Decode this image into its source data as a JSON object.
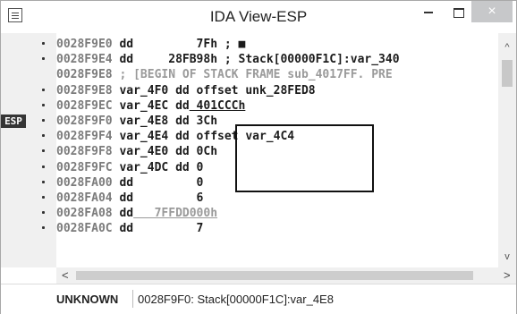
{
  "window": {
    "title": "IDA View-ESP",
    "system_icon": "document-icon",
    "minimize_label": "–",
    "maximize_label": "□",
    "close_label": "×"
  },
  "esp_marker": "ESP",
  "lines": [
    {
      "addr": "0028F9E0",
      "op": "dd",
      "rest": "        7Fh ; ■",
      "style": "normal",
      "dot": true
    },
    {
      "addr": "0028F9E4",
      "op": "dd",
      "rest": "    28FB98h ; Stack[00000F1C]:var_340",
      "style": "normal",
      "dot": true
    },
    {
      "addr": "0028F9E8",
      "op": "",
      "rest": "; [BEGIN OF STACK FRAME sub_4017FF. PRE",
      "style": "comment",
      "dot": false
    },
    {
      "addr": "0028F9E8",
      "op": "var_4F0 dd",
      "rest": "offset unk_28FED8",
      "style": "normal",
      "dot": true
    },
    {
      "addr": "0028F9EC",
      "op": "var_4EC dd",
      "rest": "401CCCh",
      "style": "underline",
      "dot": true
    },
    {
      "addr": "0028F9F0",
      "op": "var_4E8 dd",
      "rest": "3Ch",
      "style": "normal",
      "dot": true
    },
    {
      "addr": "0028F9F4",
      "op": "var_4E4 dd",
      "rest": "offset var_4C4",
      "style": "normal",
      "dot": true
    },
    {
      "addr": "0028F9F8",
      "op": "var_4E0 dd",
      "rest": "0Ch",
      "style": "normal",
      "dot": true
    },
    {
      "addr": "0028F9FC",
      "op": "var_4DC dd",
      "rest": "0",
      "style": "normal",
      "dot": true
    },
    {
      "addr": "0028FA00",
      "op": "dd",
      "rest": "        0",
      "style": "normal",
      "dot": true
    },
    {
      "addr": "0028FA04",
      "op": "dd",
      "rest": "        6",
      "style": "normal",
      "dot": true
    },
    {
      "addr": "0028FA08",
      "op": "dd",
      "rest": "  7FFDD000h",
      "style": "dimunderline",
      "dot": true
    },
    {
      "addr": "0028FA0C",
      "op": "dd",
      "rest": "        7",
      "style": "normal",
      "dot": true
    }
  ],
  "scroll": {
    "up_icon": "chevron-up-icon",
    "down_icon": "chevron-down-icon",
    "left_icon": "chevron-left-icon",
    "right_icon": "chevron-right-icon",
    "up": "^",
    "down": "v",
    "left": "<",
    "right": ">"
  },
  "status": {
    "left": "UNKNOWN",
    "right": "0028F9F0: Stack[00000F1C]:var_4E8"
  }
}
